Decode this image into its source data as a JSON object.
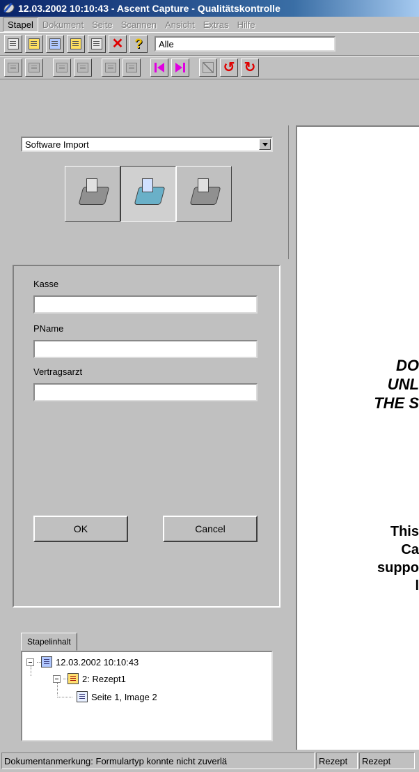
{
  "window": {
    "title": "12.03.2002 10:10:43 - Ascent Capture - Qualitätskontrolle"
  },
  "menu": [
    "Stapel",
    "Dokument",
    "Seite",
    "Scannen",
    "Ansicht",
    "Extras",
    "Hilfe"
  ],
  "toolbar": {
    "filter_value": "Alle"
  },
  "scan": {
    "source_value": "Software Import"
  },
  "index_fields": [
    {
      "label": "Kasse",
      "value": ""
    },
    {
      "label": "PName",
      "value": ""
    },
    {
      "label": "Vertragsarzt",
      "value": ""
    }
  ],
  "buttons": {
    "ok": "OK",
    "cancel": "Cancel"
  },
  "batch_tree": {
    "tab_label": "Stapelinhalt",
    "root": "12.03.2002 10:10:43",
    "document": "2: Rezept1",
    "page": "Seite 1, Image 2"
  },
  "viewer": {
    "line1": "DO",
    "line2": "UNL",
    "line3": "THE S",
    "line4": "This",
    "line5": "Ca",
    "line6": "suppo",
    "line7": "l"
  },
  "statusbar": {
    "message": "Dokumentanmerkung: Formulartyp konnte nicht zuverlä",
    "cell2": "Rezept",
    "cell3": "Rezept"
  }
}
